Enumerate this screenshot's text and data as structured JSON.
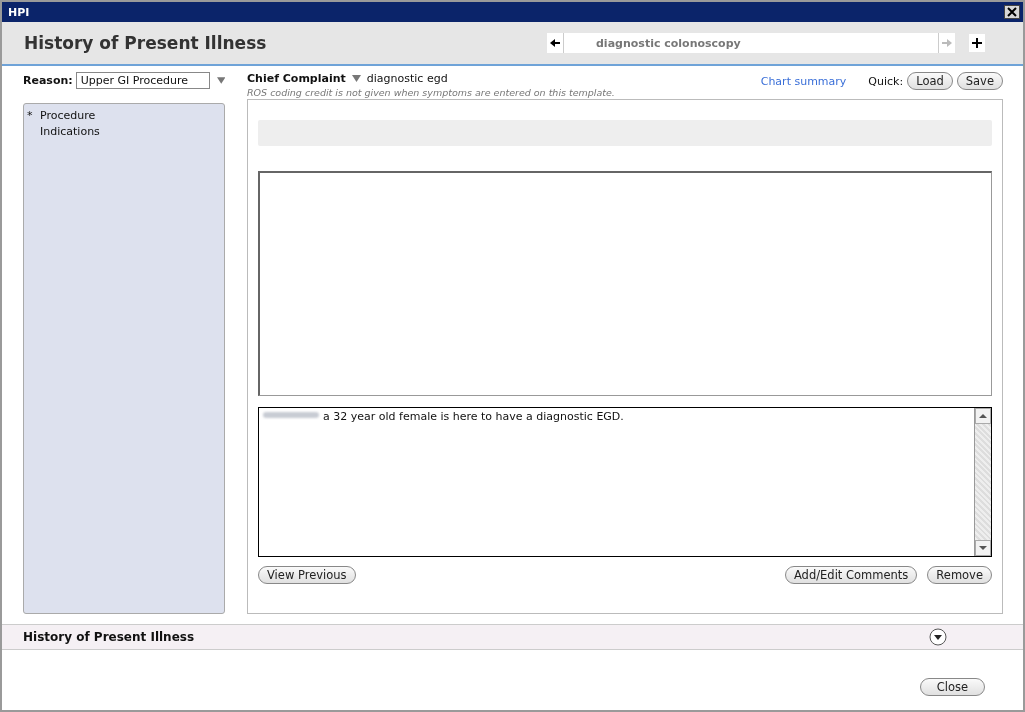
{
  "window": {
    "title": "HPI"
  },
  "header": {
    "title": "History of Present Illness",
    "tab": "diagnostic colonoscopy"
  },
  "reason": {
    "label": "Reason:",
    "value": "Upper GI Procedure"
  },
  "sidebar": {
    "items": [
      {
        "mark": "*",
        "label": "Procedure"
      },
      {
        "label": "Indications"
      }
    ]
  },
  "chief_complaint": {
    "label": "Chief Complaint",
    "value": "diagnostic egd",
    "note": "ROS coding credit is not given when symptoms are entered on this template."
  },
  "links": {
    "chart_summary": "Chart summary",
    "quick_label": "Quick:",
    "buttons": [
      "Load",
      "Save"
    ]
  },
  "narrative": "a 32 year old female is here to have a diagnostic EGD.",
  "panel_buttons": {
    "left": "View Previous",
    "right": [
      "Add/Edit Comments",
      "Remove"
    ]
  },
  "section": {
    "title": "History of Present Illness"
  },
  "footer": {
    "button": "Close"
  }
}
